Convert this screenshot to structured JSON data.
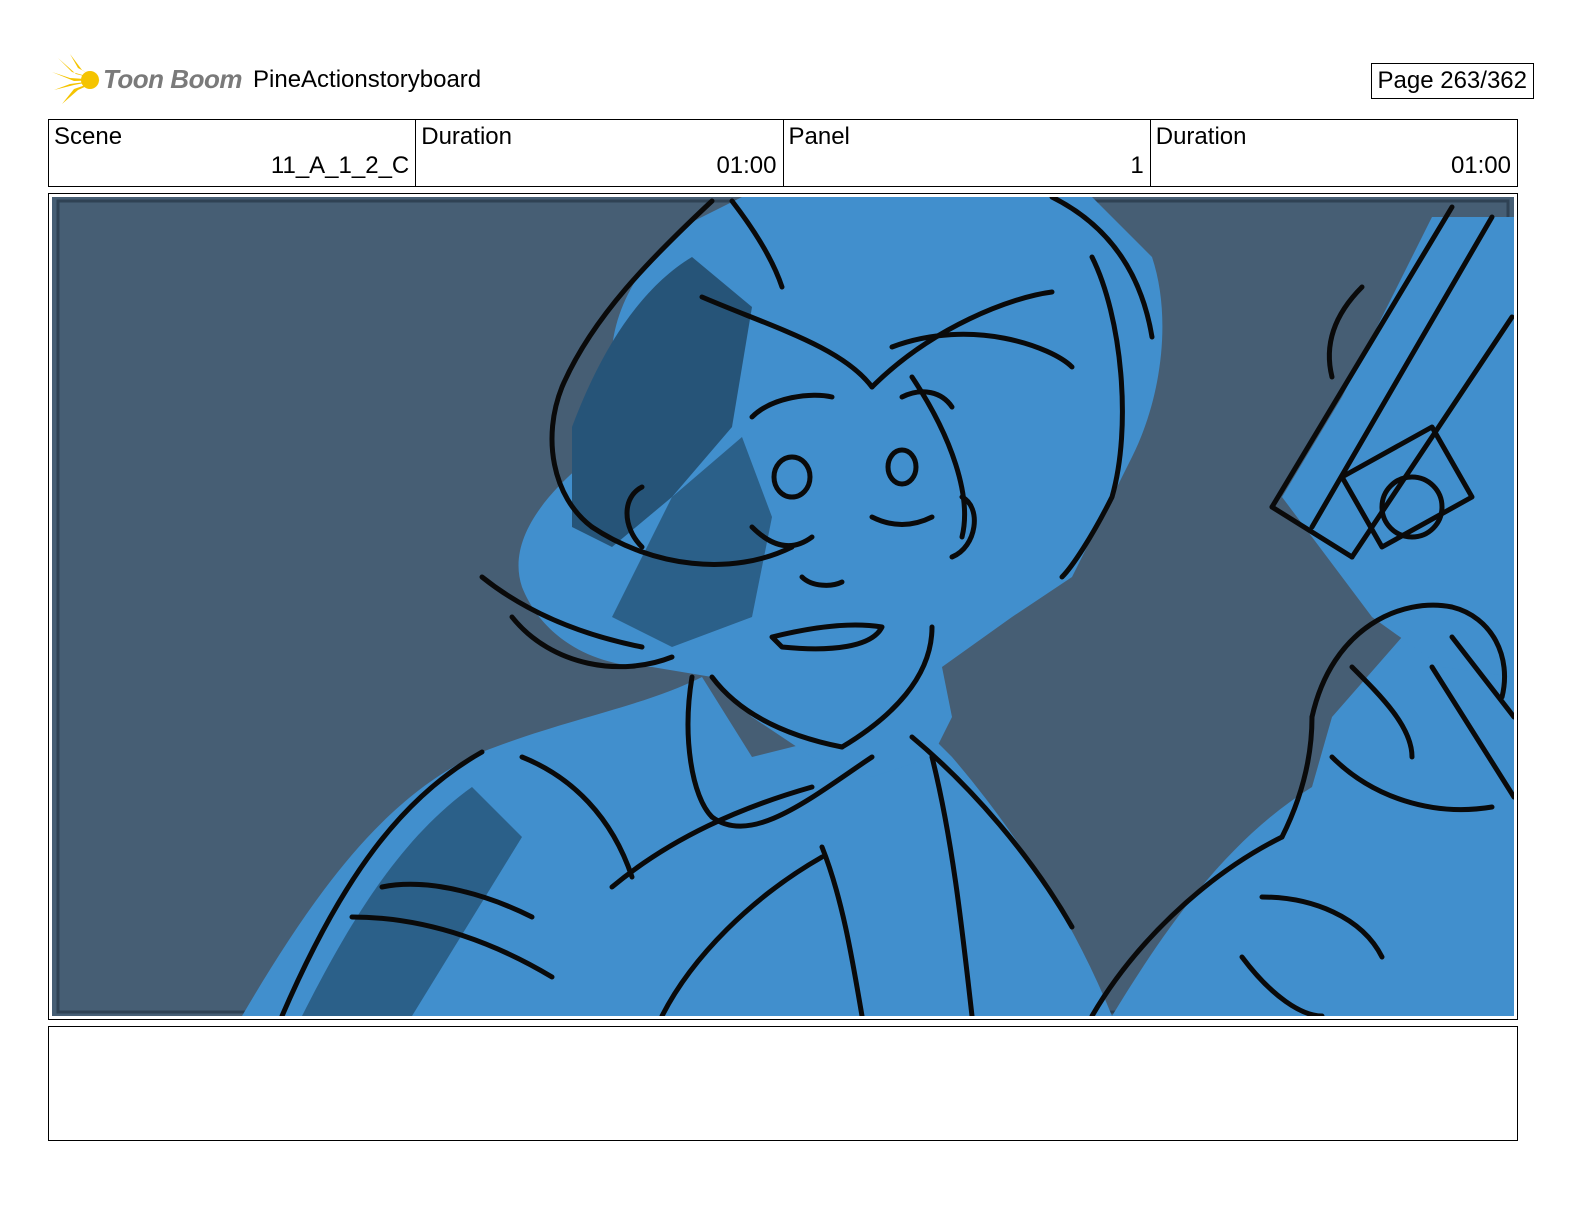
{
  "header": {
    "logo_text": "Toon Boom",
    "project_title": "PineActionstoryboard",
    "page_label": "Page 263/362"
  },
  "info": {
    "scene_label": "Scene",
    "scene_value": "11_A_1_2_C",
    "duration_label": "Duration",
    "duration_value": "01:00",
    "panel_label": "Panel",
    "panel_value": "1",
    "panel_duration_label": "Duration",
    "panel_duration_value": "01:00"
  },
  "panel": {
    "description": "",
    "colors": {
      "background": "#465e74",
      "character_fill": "#418fcd",
      "shadow": "#265478",
      "lines": "#0a0a0a"
    }
  },
  "notes": {
    "text": ""
  }
}
